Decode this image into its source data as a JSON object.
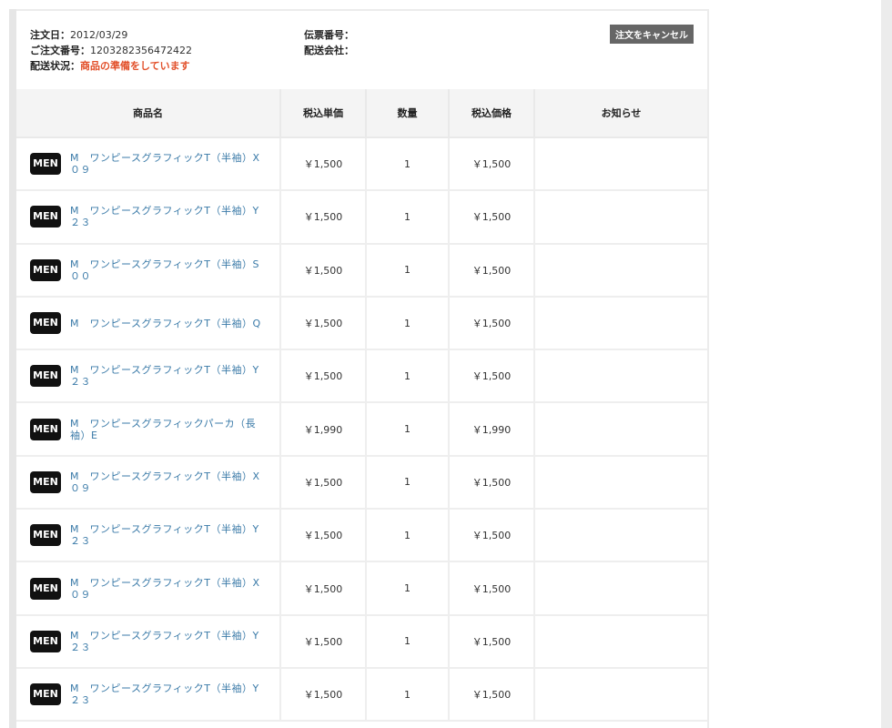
{
  "order": {
    "date_label": "注文日：",
    "date": "2012/03/29",
    "number_label": "ご注文番号：",
    "number": "1203282356472422",
    "status_label": "配送状況：",
    "status": "商品の準備をしています",
    "slip_label": "伝票番号：",
    "carrier_label": "配送会社：",
    "cancel_label": "注文をキャンセル"
  },
  "table": {
    "headers": [
      "商品名",
      "税込単価",
      "数量",
      "税込価格",
      "お知らせ"
    ],
    "rows": [
      {
        "badge": "MEN",
        "name": "M　ワンピースグラフィックT（半袖）X０９",
        "unit": "￥1,500",
        "qty": "1",
        "price": "￥1,500"
      },
      {
        "badge": "MEN",
        "name": "M　ワンピースグラフィックT（半袖）Y２３",
        "unit": "￥1,500",
        "qty": "1",
        "price": "￥1,500"
      },
      {
        "badge": "MEN",
        "name": "M　ワンピースグラフィックT（半袖）S００",
        "unit": "￥1,500",
        "qty": "1",
        "price": "￥1,500"
      },
      {
        "badge": "MEN",
        "name": "M　ワンピースグラフィックT（半袖）Q",
        "unit": "￥1,500",
        "qty": "1",
        "price": "￥1,500"
      },
      {
        "badge": "MEN",
        "name": "M　ワンピースグラフィックT（半袖）Y２３",
        "unit": "￥1,500",
        "qty": "1",
        "price": "￥1,500"
      },
      {
        "badge": "MEN",
        "name": "M　ワンピースグラフィックパーカ（長袖）E",
        "unit": "￥1,990",
        "qty": "1",
        "price": "￥1,990"
      },
      {
        "badge": "MEN",
        "name": "M　ワンピースグラフィックT（半袖）X０９",
        "unit": "￥1,500",
        "qty": "1",
        "price": "￥1,500"
      },
      {
        "badge": "MEN",
        "name": "M　ワンピースグラフィックT（半袖）Y２３",
        "unit": "￥1,500",
        "qty": "1",
        "price": "￥1,500"
      },
      {
        "badge": "MEN",
        "name": "M　ワンピースグラフィックT（半袖）X０９",
        "unit": "￥1,500",
        "qty": "1",
        "price": "￥1,500"
      },
      {
        "badge": "MEN",
        "name": "M　ワンピースグラフィックT（半袖）Y２３",
        "unit": "￥1,500",
        "qty": "1",
        "price": "￥1,500"
      },
      {
        "badge": "MEN",
        "name": "M　ワンピースグラフィックT（半袖）Y２３",
        "unit": "￥1,500",
        "qty": "1",
        "price": "￥1,500"
      }
    ]
  }
}
